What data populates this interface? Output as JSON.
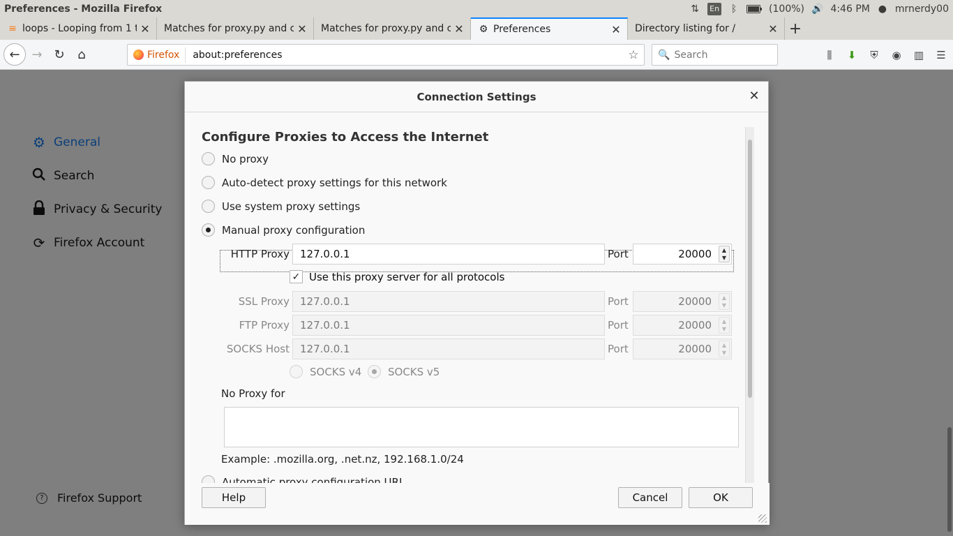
{
  "os_panel": {
    "window_title": "Preferences - Mozilla Firefox",
    "lang": "En",
    "battery": "(100%)",
    "time": "4:46 PM",
    "user": "mrnerdy00"
  },
  "tabs": [
    {
      "label": "loops - Looping from 1 t",
      "favicon": "stack-overflow-icon"
    },
    {
      "label": "Matches for proxy.py and cl",
      "favicon": ""
    },
    {
      "label": "Matches for proxy.py and cl",
      "favicon": ""
    },
    {
      "label": "Preferences",
      "favicon": "gear-icon",
      "active": true
    },
    {
      "label": "Directory listing for /",
      "favicon": ""
    }
  ],
  "navbar": {
    "identity_label": "Firefox",
    "url": "about:preferences",
    "search_placeholder": "Search"
  },
  "prefs_nav": [
    {
      "label": "General",
      "icon": "gear-icon",
      "active": true
    },
    {
      "label": "Search",
      "icon": "search-icon"
    },
    {
      "label": "Privacy & Security",
      "icon": "lock-icon"
    },
    {
      "label": "Firefox Account",
      "icon": "sync-icon"
    }
  ],
  "prefs_support": "Firefox Support",
  "dialog": {
    "title": "Connection Settings",
    "section_title": "Configure Proxies to Access the Internet",
    "options": {
      "no_proxy": "No proxy",
      "auto_detect": "Auto-detect proxy settings for this network",
      "system": "Use system proxy settings",
      "manual": "Manual proxy configuration",
      "auto_url": "Automatic proxy configuration URL"
    },
    "selected_option": "manual",
    "http": {
      "label": "HTTP Proxy",
      "value": "127.0.0.1",
      "port_label": "Port",
      "port": "20000"
    },
    "use_all": {
      "label": "Use this proxy server for all protocols",
      "checked": true
    },
    "ssl": {
      "label": "SSL Proxy",
      "value": "127.0.0.1",
      "port_label": "Port",
      "port": "20000"
    },
    "ftp": {
      "label": "FTP Proxy",
      "value": "127.0.0.1",
      "port_label": "Port",
      "port": "20000"
    },
    "socks": {
      "label": "SOCKS Host",
      "value": "127.0.0.1",
      "port_label": "Port",
      "port": "20000"
    },
    "socks_v4": "SOCKS v4",
    "socks_v5": "SOCKS v5",
    "socks_selected": "v5",
    "no_proxy_for_label": "No Proxy for",
    "no_proxy_for_value": "",
    "example": "Example: .mozilla.org, .net.nz, 192.168.1.0/24",
    "buttons": {
      "help": "Help",
      "cancel": "Cancel",
      "ok": "OK"
    }
  },
  "colors": {
    "accent": "#0a84ff",
    "overlay": "#7f7f7f"
  }
}
